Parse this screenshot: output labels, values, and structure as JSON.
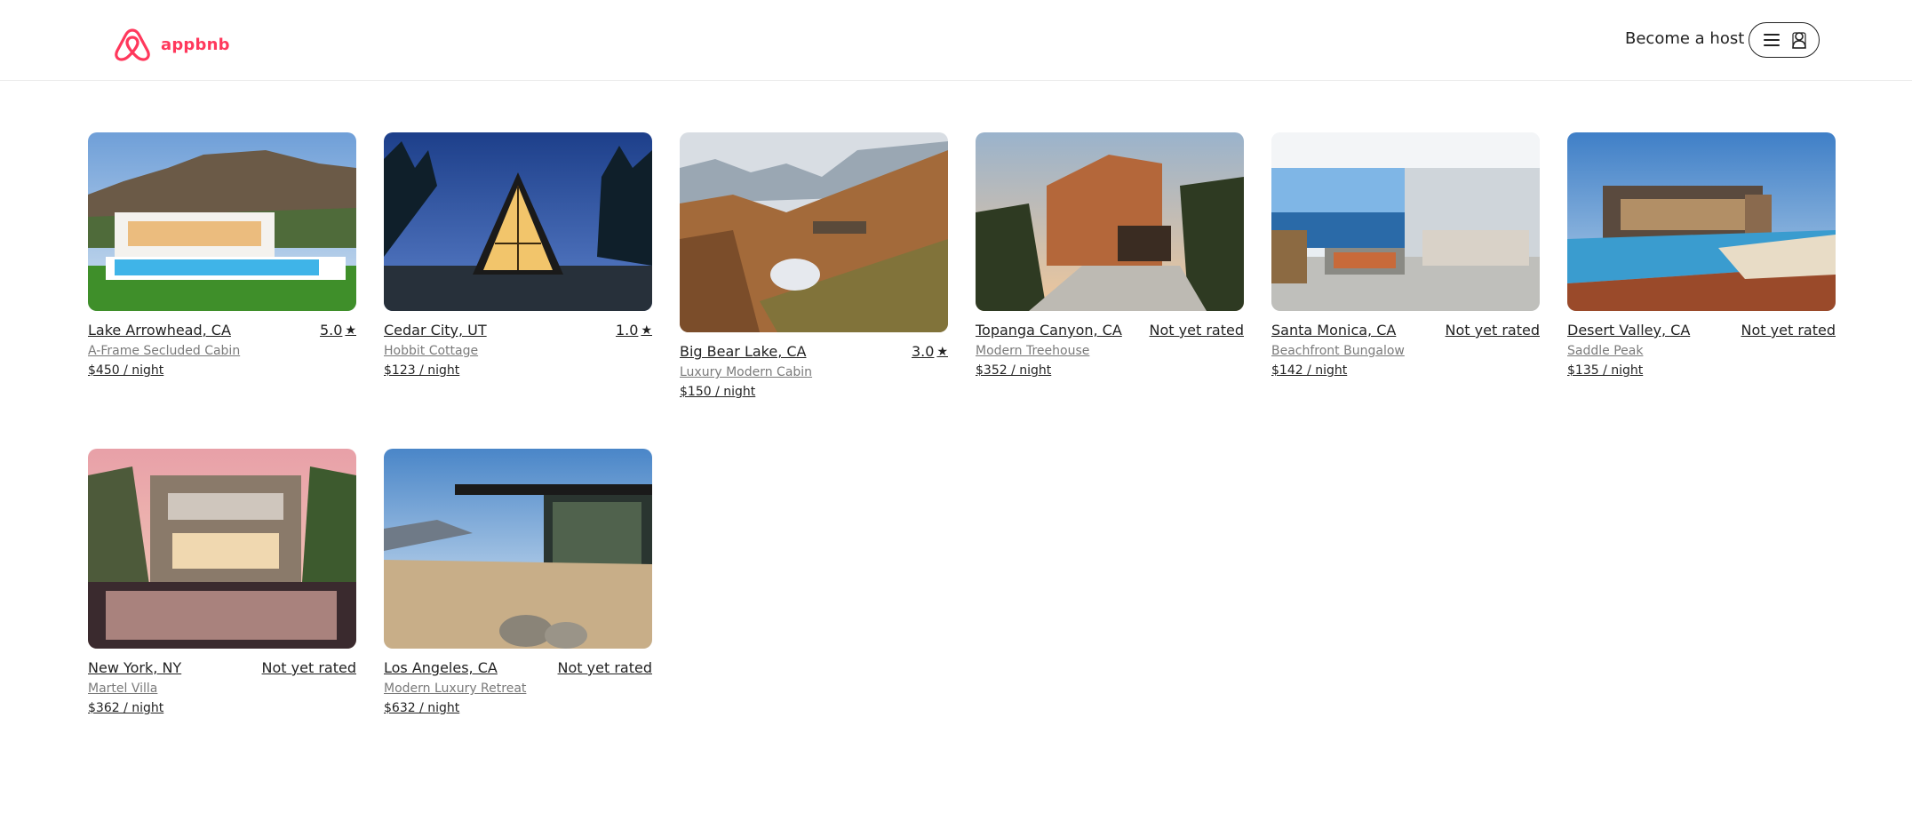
{
  "header": {
    "logo_text": "appbnb",
    "become_host": "Become a host",
    "menu_icon": "hamburger-menu-icon",
    "avatar_icon": "user-avatar-icon"
  },
  "colors": {
    "brand": "#FF385C",
    "text": "#222222",
    "muted": "#7a7a7a"
  },
  "listings": [
    {
      "location": "Lake Arrowhead, CA",
      "rating": "5.0",
      "title": "A-Frame Secluded Cabin",
      "price": "$450 / night"
    },
    {
      "location": "Cedar City, UT",
      "rating": "1.0",
      "title": "Hobbit Cottage",
      "price": "$123 / night"
    },
    {
      "location": "Big Bear Lake, CA",
      "rating": "3.0",
      "title": "Luxury Modern Cabin",
      "price": "$150 / night"
    },
    {
      "location": "Topanga Canyon, CA",
      "rating": "Not yet rated",
      "title": "Modern Treehouse",
      "price": "$352 / night"
    },
    {
      "location": "Santa Monica, CA",
      "rating": "Not yet rated",
      "title": "Beachfront Bungalow",
      "price": "$142 / night"
    },
    {
      "location": "Desert Valley, CA",
      "rating": "Not yet rated",
      "title": "Saddle Peak",
      "price": "$135 / night"
    },
    {
      "location": "New York, NY",
      "rating": "Not yet rated",
      "title": "Martel Villa",
      "price": "$362 / night"
    },
    {
      "location": "Los Angeles, CA",
      "rating": "Not yet rated",
      "title": "Modern Luxury Retreat",
      "price": "$632 / night"
    }
  ]
}
